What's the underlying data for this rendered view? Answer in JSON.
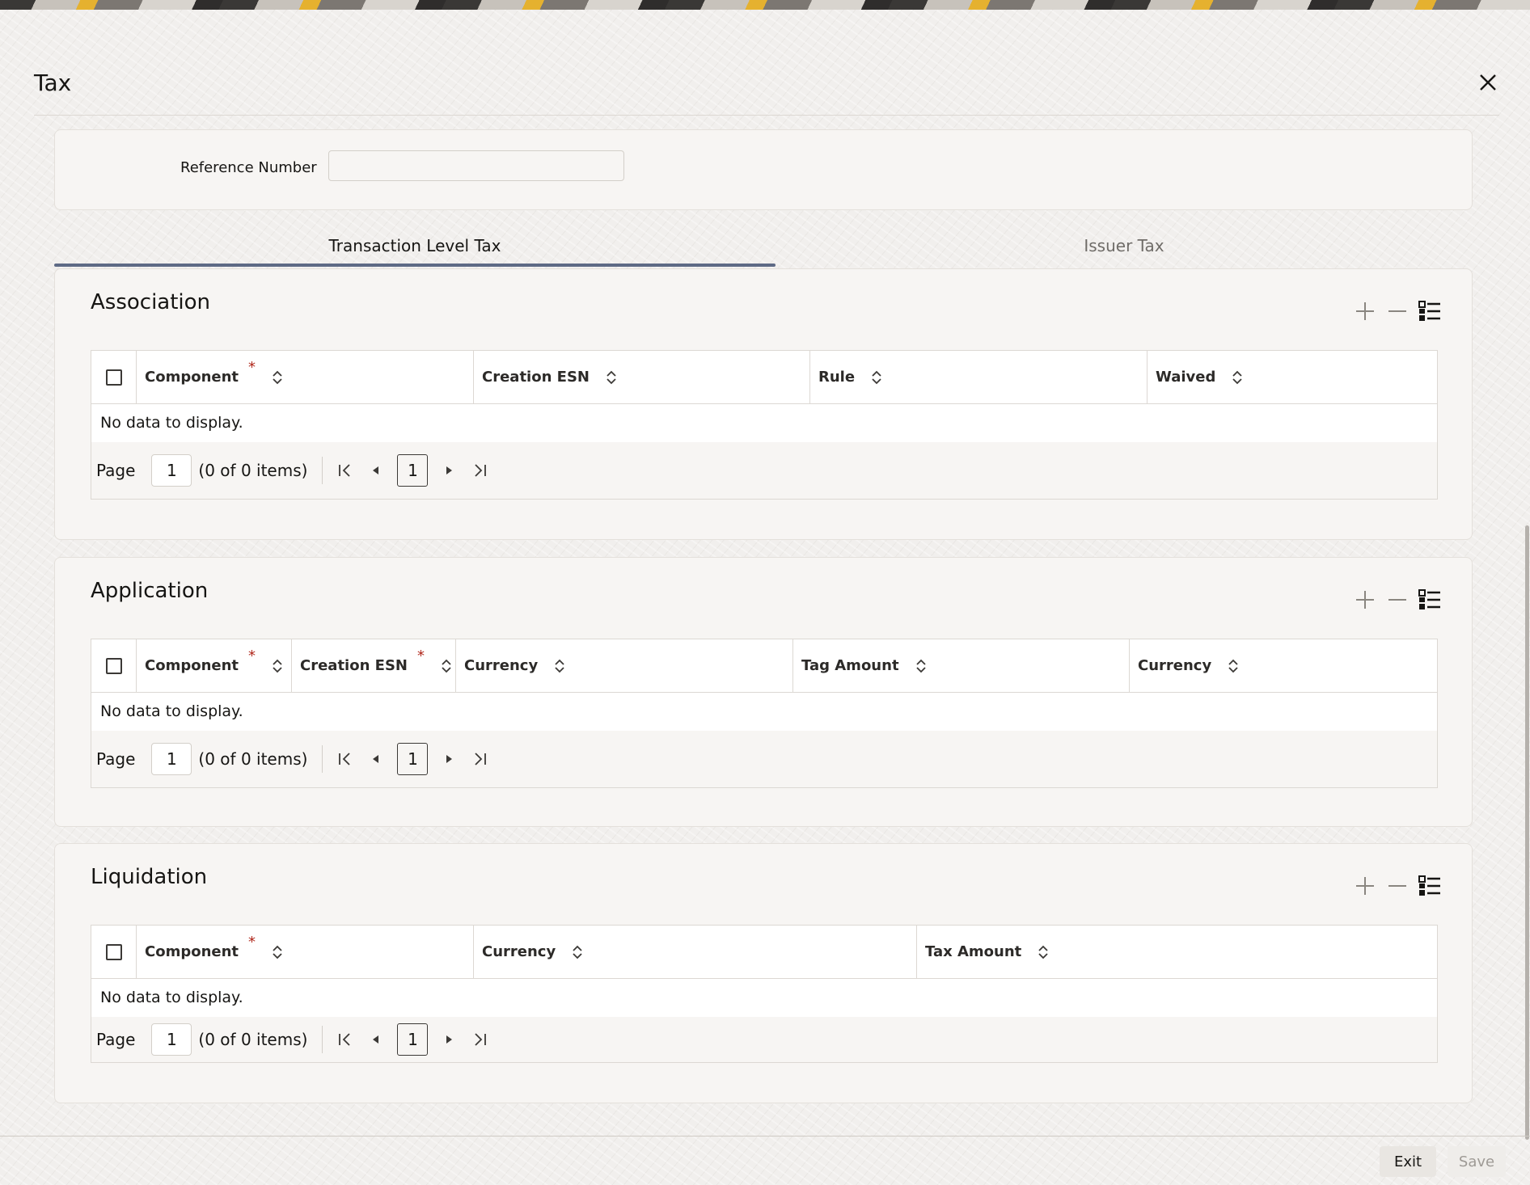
{
  "window": {
    "title": "Tax"
  },
  "header_form": {
    "reference_label": "Reference Number",
    "reference_value": ""
  },
  "tabs": [
    {
      "label": "Transaction Level Tax",
      "active": true
    },
    {
      "label": "Issuer Tax",
      "active": false
    }
  ],
  "association": {
    "title": "Association",
    "columns": [
      {
        "label": "Component",
        "required": true
      },
      {
        "label": "Creation ESN",
        "required": false
      },
      {
        "label": "Rule",
        "required": false
      },
      {
        "label": "Waived",
        "required": false
      }
    ],
    "empty_text": "No data to display.",
    "pager": {
      "label": "Page",
      "page": "1",
      "count_text": "(0 of 0 items)",
      "current": "1"
    }
  },
  "application": {
    "title": "Application",
    "columns": [
      {
        "label": "Component",
        "required": true
      },
      {
        "label": "Creation ESN",
        "required": true
      },
      {
        "label": "Currency",
        "required": false
      },
      {
        "label": "Tag Amount",
        "required": false
      },
      {
        "label": "Currency",
        "required": false
      }
    ],
    "empty_text": "No data to display.",
    "pager": {
      "label": "Page",
      "page": "1",
      "count_text": "(0 of 0 items)",
      "current": "1"
    }
  },
  "liquidation": {
    "title": "Liquidation",
    "columns": [
      {
        "label": "Component",
        "required": true
      },
      {
        "label": "Currency",
        "required": false
      },
      {
        "label": "Tax Amount",
        "required": false
      }
    ],
    "empty_text": "No data to display.",
    "pager": {
      "label": "Page",
      "page": "1",
      "count_text": "(0 of 0 items)",
      "current": "1"
    }
  },
  "footer": {
    "exit_label": "Exit",
    "save_label": "Save"
  },
  "colors": {
    "tab_accent": "#5e6a85",
    "required_marker": "#b0271b"
  }
}
